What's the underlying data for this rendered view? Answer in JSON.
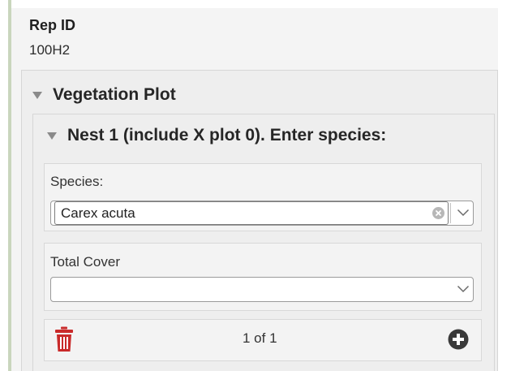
{
  "rep_id": {
    "label": "Rep ID",
    "value": "100H2"
  },
  "vegetation_plot": {
    "title": "Vegetation Plot",
    "nest": {
      "title": "Nest 1 (include X plot 0). Enter species:",
      "species": {
        "label": "Species:",
        "value": "Carex acuta"
      },
      "total_cover": {
        "label": "Total Cover",
        "value": ""
      },
      "pager": {
        "text": "1 of 1"
      }
    }
  },
  "colors": {
    "trash": "#c92a2a",
    "add": "#3a3a3a",
    "accent_bar": "#c9d6bd"
  },
  "icons": {
    "collapse": "triangle-down-icon",
    "clear": "clear-circle-icon",
    "dropdown": "chevron-down-icon",
    "delete": "trash-icon",
    "add": "plus-circle-icon"
  }
}
